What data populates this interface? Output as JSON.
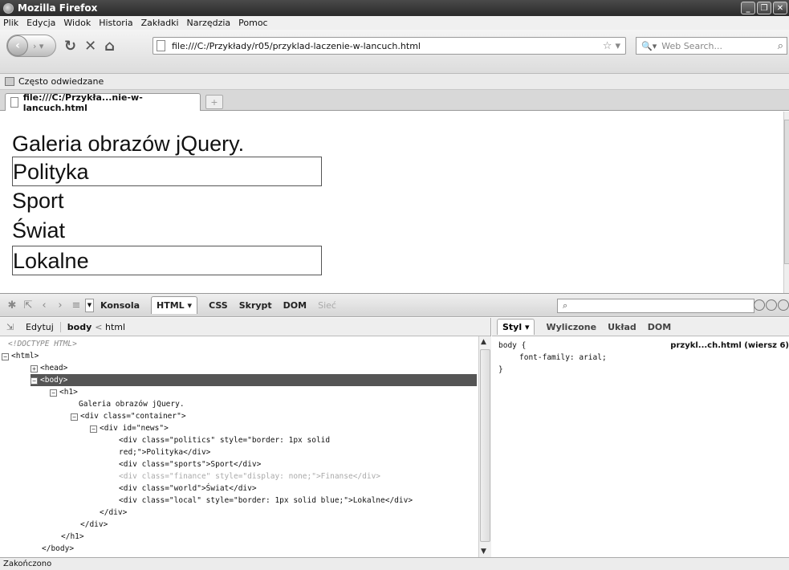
{
  "window": {
    "title": "Mozilla Firefox"
  },
  "menu": [
    "Plik",
    "Edycja",
    "Widok",
    "Historia",
    "Zakładki",
    "Narzędzia",
    "Pomoc"
  ],
  "nav": {
    "url": "file:///C:/Przykłady/r05/przyklad-laczenie-w-lancuch.html",
    "search_placeholder": "Web Search..."
  },
  "bookmarks": {
    "item": "Często odwiedzane"
  },
  "tab": {
    "title": "file:///C:/Przykła...nie-w-lancuch.html"
  },
  "page": {
    "heading": "Galeria obrazów jQuery.",
    "items": [
      "Polityka",
      "Sport",
      "Świat",
      "Lokalne"
    ]
  },
  "firebug": {
    "tabs": [
      "Konsola",
      "HTML ▾",
      "CSS",
      "Skrypt",
      "DOM",
      "Sieć"
    ],
    "breadcrumb": {
      "edit": "Edytuj",
      "current": "body",
      "parent": "html"
    },
    "tree": [
      "<!DOCTYPE HTML>",
      "<html>",
      "<head>",
      "<body>",
      "<h1>",
      "Galeria obrazów jQuery.",
      "<div class=\"container\">",
      "<div id=\"news\">",
      "<div class=\"politics\" style=\"border: 1px solid",
      "red;\">Polityka</div>",
      "<div class=\"sports\">Sport</div>",
      "<div class=\"finance\" style=\"display: none;\">Finanse</div>",
      "<div class=\"world\">Świat</div>",
      "<div class=\"local\" style=\"border: 1px solid blue;\">Lokalne</div>",
      "</div>",
      "</div>",
      "</h1>",
      "</body>"
    ],
    "style_tabs": [
      "Styl ▾",
      "Wyliczone",
      "Układ",
      "DOM"
    ],
    "css": {
      "selector": "body {",
      "rule": "font-family: arial;",
      "close": "}",
      "source": "przykl...ch.html (wiersz 6)"
    }
  },
  "status": {
    "text": "Zakończono"
  }
}
